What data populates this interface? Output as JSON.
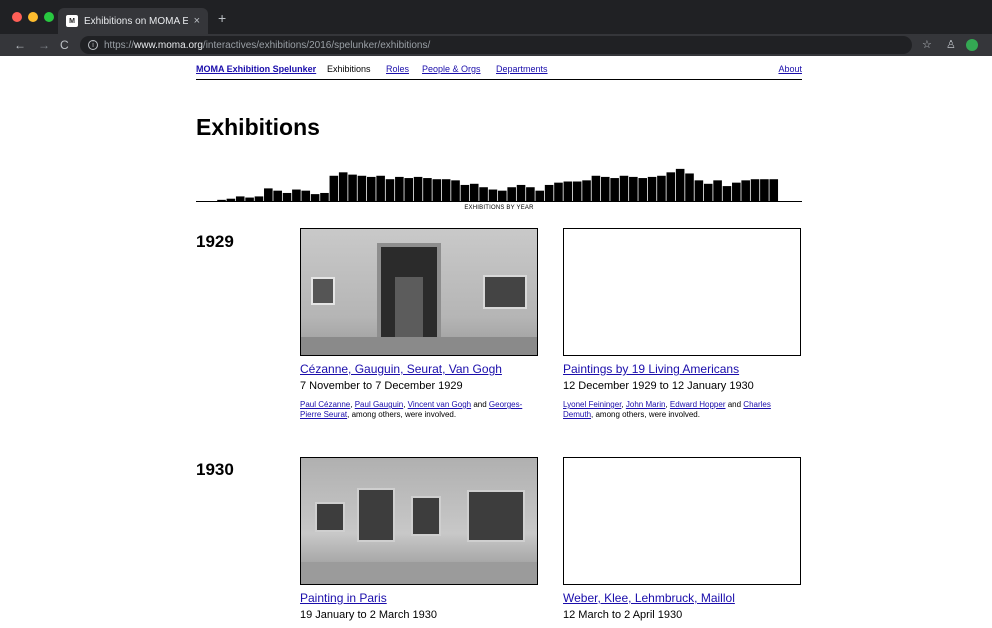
{
  "browser": {
    "tab_title": "Exhibitions on MOMA Exhibitio",
    "tab_close": "×",
    "new_tab": "+",
    "url_scheme": "https://",
    "url_host": "www.moma.org",
    "url_path": "/interactives/exhibitions/2016/spelunker/exhibitions/",
    "nav_back": "←",
    "nav_forward": "→",
    "nav_reload": "C",
    "info": "i",
    "star": "☆",
    "extension": "♙",
    "profile_color": "#34a853"
  },
  "nav": {
    "home": "MOMA Exhibition Spelunker",
    "exhibitions": "Exhibitions",
    "roles": "Roles",
    "people": "People & Orgs",
    "departments": "Departments",
    "about": "About"
  },
  "page": {
    "title": "Exhibitions",
    "histogram_caption": "EXHIBITIONS BY YEAR"
  },
  "chart_data": {
    "type": "bar",
    "title": "",
    "xlabel": "EXHIBITIONS BY YEAR",
    "ylabel": "",
    "ylim": [
      0,
      34
    ],
    "values": [
      1,
      2,
      4,
      3,
      4,
      11,
      9,
      7,
      10,
      9,
      6,
      7,
      22,
      25,
      23,
      22,
      21,
      22,
      19,
      21,
      20,
      21,
      20,
      19,
      19,
      18,
      14,
      15,
      12,
      10,
      9,
      12,
      14,
      12,
      9,
      14,
      16,
      17,
      17,
      18,
      22,
      21,
      20,
      22,
      21,
      20,
      21,
      22,
      25,
      28,
      24,
      18,
      15,
      18,
      13,
      16,
      18,
      19,
      19,
      19
    ]
  },
  "years": [
    {
      "year": "1929",
      "cards": [
        {
          "title": "Cézanne, Gauguin, Seurat, Van Gogh",
          "dates": "7 November to 7 December 1929",
          "people": [
            "Paul Cézanne",
            "Paul Gauguin",
            "Vincent van Gogh",
            "Georges-Pierre Seurat"
          ],
          "sep1": ", ",
          "sep2": ", ",
          "and": " and ",
          "tail": ", among others, were involved."
        },
        {
          "title": "Paintings by 19 Living Americans",
          "dates": "12 December 1929 to 12 January 1930",
          "people": [
            "Lyonel Feininger",
            "John Marin",
            "Edward Hopper",
            "Charles Demuth"
          ],
          "sep1": ", ",
          "sep2": ", ",
          "and": " and ",
          "tail": ", among others, were involved."
        }
      ]
    },
    {
      "year": "1930",
      "cards": [
        {
          "title": "Painting in Paris",
          "dates": "19 January to 2 March 1930"
        },
        {
          "title": "Weber, Klee, Lehmbruck, Maillol",
          "dates": "12 March to 2 April 1930"
        }
      ]
    }
  ]
}
